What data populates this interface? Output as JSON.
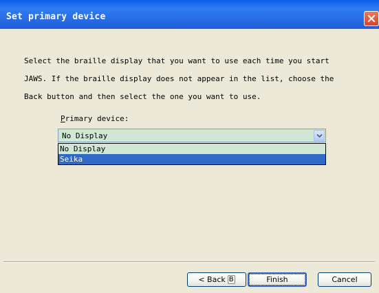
{
  "window": {
    "title": "Set primary device"
  },
  "instructions": {
    "line1": "Select the braille display that you want to use each time you start",
    "line2": "JAWS. If the braille display does not appear in the list, choose the",
    "line3": "Back button and then select the one you want to use."
  },
  "primary_device": {
    "label_mnemonic": "P",
    "label_rest": "rimary device:",
    "selected_value": "No Display",
    "options": [
      "No Display",
      "Seika"
    ],
    "highlighted_option": "Seika"
  },
  "buttons": {
    "back_label": "< Back",
    "back_key": "B",
    "finish_label": "Finish",
    "cancel_label": "Cancel"
  },
  "icons": {
    "close": "close-icon",
    "dropdown": "chevron-down-icon"
  },
  "colors": {
    "titlebar": "#2a6fe6",
    "close_button": "#d2452b",
    "list_background": "#cfe7d3",
    "selection": "#316ac5",
    "dialog_background": "#ece9d8"
  }
}
